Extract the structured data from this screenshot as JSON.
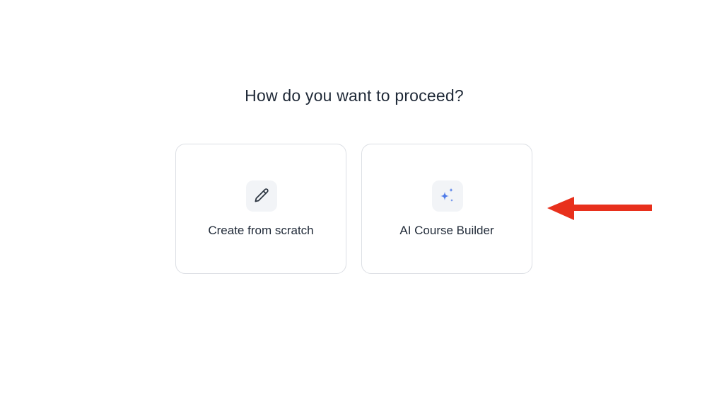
{
  "prompt": {
    "title": "How do you want to proceed?"
  },
  "options": [
    {
      "label": "Create from scratch",
      "icon": "pencil-icon"
    },
    {
      "label": "AI Course Builder",
      "icon": "sparkles-icon"
    }
  ],
  "annotation": {
    "icon": "red-arrow-icon",
    "color": "#e8301c"
  },
  "colors": {
    "sparkle": "#4f7be8",
    "pencil": "#2b3440",
    "card_border": "#dcdfe4",
    "icon_bg": "#f2f4f7"
  }
}
